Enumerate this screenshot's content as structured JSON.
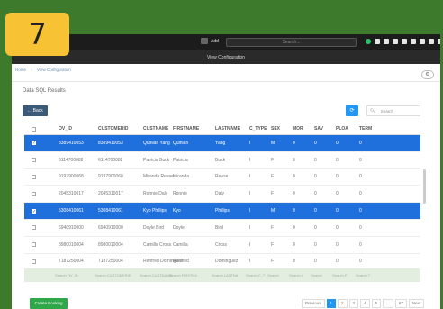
{
  "badge": {
    "number": "7"
  },
  "topbar": {
    "add_label": "Add",
    "search_placeholder": "Search...",
    "subtitle": "View Configuration"
  },
  "breadcrumb": {
    "home": "Home",
    "sep": "›",
    "current": "View Configuration"
  },
  "page": {
    "section_title": "Data SQL Results",
    "back_label": "← Back",
    "table_search_placeholder": "Search"
  },
  "table": {
    "columns": [
      "OV_ID",
      "CUSTOMERID",
      "CUSTNAME",
      "FIRSTNAME",
      "LASTNAME",
      "C_TYPE",
      "SEX",
      "MOR",
      "SAV",
      "PLOA",
      "TERM"
    ],
    "rows": [
      {
        "selected": true,
        "cells": [
          "8389410053",
          "8389410053",
          "Quinlan Yang",
          "Quinlan",
          "Yang",
          "I",
          "M",
          "0",
          "0",
          "0",
          "0"
        ]
      },
      {
        "selected": false,
        "cells": [
          "6114700088",
          "6114700088",
          "Patricia Buck",
          "Patricia",
          "Buck",
          "I",
          "F",
          "0",
          "0",
          "0",
          "0"
        ]
      },
      {
        "selected": false,
        "cells": [
          "9197900068",
          "9197900068",
          "Miranda Reese",
          "Miranda",
          "Reese",
          "I",
          "F",
          "0",
          "0",
          "0",
          "0"
        ]
      },
      {
        "selected": false,
        "cells": [
          "2045310017",
          "2045310017",
          "Ronnie Daly",
          "Ronnie",
          "Daly",
          "I",
          "F",
          "0",
          "0",
          "0",
          "0"
        ]
      },
      {
        "selected": true,
        "cells": [
          "5308410061",
          "5308410061",
          "Kyo Phillips",
          "Kyo",
          "Phillips",
          "I",
          "M",
          "0",
          "0",
          "0",
          "0"
        ]
      },
      {
        "selected": false,
        "cells": [
          "6940910000",
          "6940910000",
          "Doyle Bird",
          "Doyle",
          "Bird",
          "I",
          "F",
          "0",
          "0",
          "0",
          "0"
        ]
      },
      {
        "selected": false,
        "cells": [
          "8980010004",
          "8980010004",
          "Camilla Cross",
          "Camilla",
          "Cross",
          "I",
          "F",
          "0",
          "0",
          "0",
          "0"
        ]
      },
      {
        "selected": false,
        "cells": [
          "7187250004",
          "7187250004",
          "Renfred Dominguez",
          "Renfred",
          "Dominguez",
          "I",
          "F",
          "0",
          "0",
          "0",
          "0"
        ]
      }
    ],
    "footer_search": [
      "Search OV_ID",
      "Search CUSTOMERID",
      "Search CUSTNAME",
      "Search FIRSTNA",
      "Search LASTNA",
      "Search C_T",
      "Search",
      "Search I",
      "Search",
      "Search P",
      "Search T"
    ]
  },
  "actions": {
    "create_label": "Create Booking"
  },
  "pager": {
    "items": [
      "Previous",
      "1",
      "2",
      "3",
      "4",
      "5",
      "...",
      "67",
      "Next"
    ],
    "active": "1"
  },
  "colors": {
    "selected_row": "#1f6fdd",
    "accent": "#2196f3",
    "create": "#2ea84a",
    "badge": "#f7c234"
  }
}
